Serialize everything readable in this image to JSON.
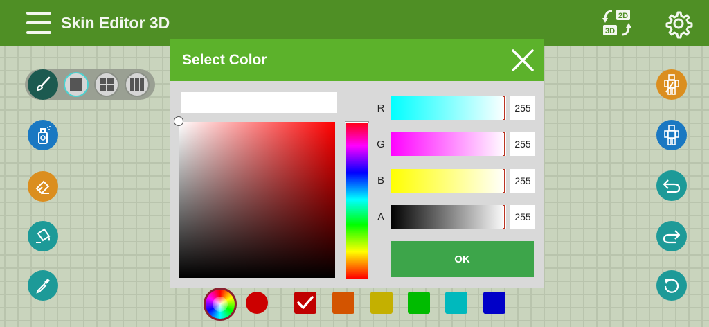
{
  "app": {
    "title": "Skin Editor 3D"
  },
  "dialog": {
    "title": "Select Color",
    "hex_value": "",
    "channels": [
      {
        "label": "R",
        "value": "255"
      },
      {
        "label": "G",
        "value": "255"
      },
      {
        "label": "B",
        "value": "255"
      },
      {
        "label": "A",
        "value": "255"
      }
    ],
    "ok_label": "OK"
  },
  "icons": {
    "menu": "hamburger-menu-icon",
    "view_toggle": "2d-3d-toggle-icon",
    "settings": "gear-icon",
    "close": "close-icon",
    "left_tools": [
      "paint-brush-icon",
      "spray-paint-icon",
      "eraser-icon",
      "paint-bucket-icon",
      "eyedropper-icon"
    ],
    "right_tools": [
      "character-edit-icon",
      "character-model-icon",
      "undo-icon",
      "redo-icon",
      "reset-icon"
    ],
    "brush_sizes": [
      "size-1x1-icon",
      "size-2x2-icon",
      "size-3x3-icon"
    ]
  },
  "palette": {
    "current_color": "#cc0000",
    "swatches": [
      "#c00000",
      "#d35400",
      "#c4b000",
      "#00bb00",
      "#00b9bd",
      "#0000c8"
    ],
    "selected_swatch": 0
  },
  "colors": {
    "topbar": "#4f8f25",
    "dialog_header": "#5cb22b",
    "ok_button": "#3da54a"
  }
}
